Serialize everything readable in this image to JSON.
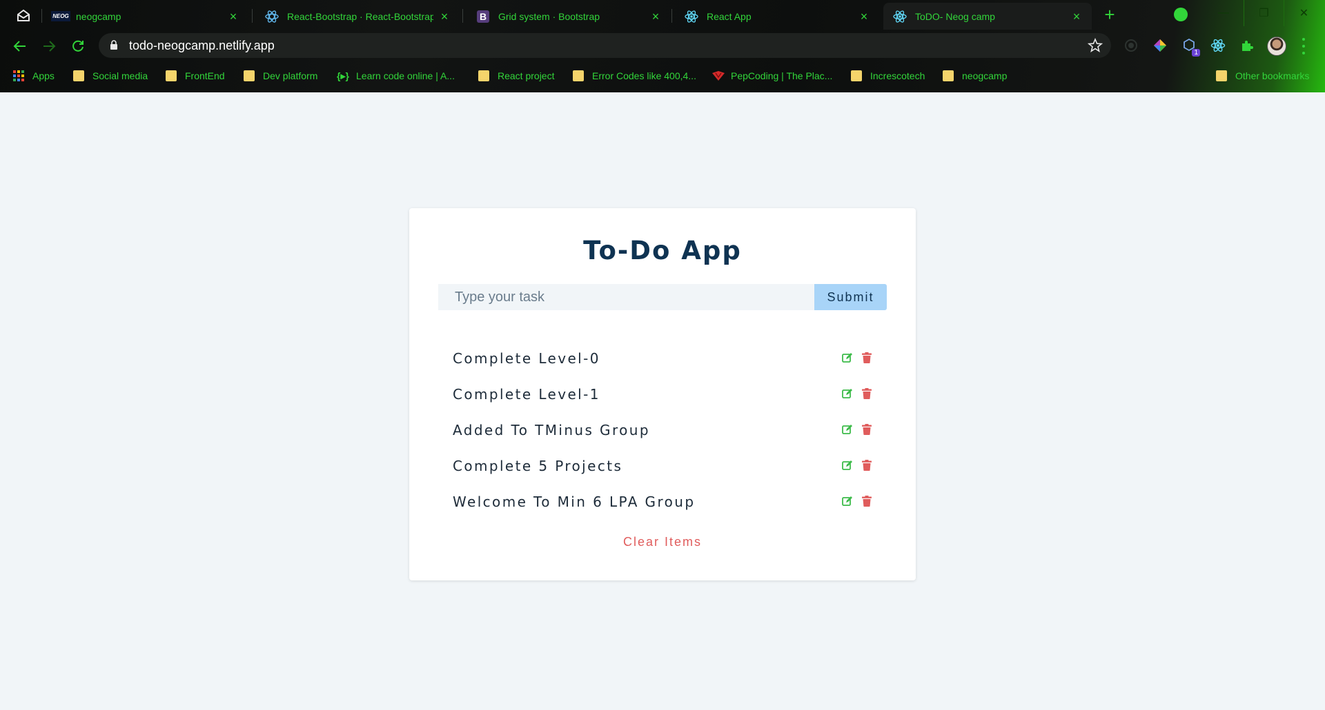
{
  "browser": {
    "tabs": [
      {
        "title": "neogcamp",
        "favicon": "neog-icon"
      },
      {
        "title": "React-Bootstrap · React-Bootstrap",
        "favicon": "react-bootstrap-icon"
      },
      {
        "title": "Grid system · Bootstrap",
        "favicon": "bootstrap-icon",
        "favicon_letter": "B"
      },
      {
        "title": "React App",
        "favicon": "react-icon"
      },
      {
        "title": "ToDO- Neog camp",
        "favicon": "react-icon",
        "active": true
      }
    ],
    "url": "todo-neogcamp.netlify.app",
    "bookmarks": [
      {
        "label": "Apps",
        "icon": "apps-grid-icon"
      },
      {
        "label": "Social media",
        "icon": "folder-icon"
      },
      {
        "label": "FrontEnd",
        "icon": "folder-icon"
      },
      {
        "label": "Dev platform",
        "icon": "folder-icon"
      },
      {
        "label": "Learn code online | A...",
        "icon": "code-icon"
      },
      {
        "label": "React project",
        "icon": "folder-icon"
      },
      {
        "label": "Error Codes like 400,4...",
        "icon": "folder-icon"
      },
      {
        "label": "PepCoding | The Plac...",
        "icon": "pepcoding-icon"
      },
      {
        "label": "Increscotech",
        "icon": "folder-icon"
      },
      {
        "label": "neogcamp",
        "icon": "folder-icon"
      }
    ],
    "other_bookmarks": "Other bookmarks",
    "extension_badge": "1",
    "neog_favicon_text": "NEOG",
    "accent_color": "#32d53a"
  },
  "app": {
    "title": "To-Do App",
    "input_placeholder": "Type your task",
    "submit_label": "Submit",
    "tasks": [
      "Complete Level-0",
      "Complete Level-1",
      "Added To TMinus Group",
      "Complete 5 Projects",
      "Welcome To Min 6 LPA Group"
    ],
    "clear_label": "Clear Items",
    "colors": {
      "title": "#0f3352",
      "submit_bg": "#a8d4f8",
      "edit_icon": "#3dbb4a",
      "delete_icon": "#e05c5c",
      "page_bg": "#f1f5f8"
    }
  }
}
